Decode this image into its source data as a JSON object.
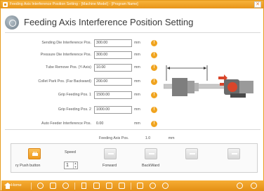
{
  "window": {
    "title": "Feeding Axis Interference Position Setting - [Machine Model] - [Program Name]",
    "close_glyph": "✕"
  },
  "header": {
    "title": "Feeding Axis Interference Position Setting",
    "icon": "gear-icon"
  },
  "params": [
    {
      "label": "Sending Die Interference Pos.",
      "value": "300.00",
      "unit": "mm"
    },
    {
      "label": "Pressure Die Interference Pos.",
      "value": "300.00",
      "unit": "mm"
    },
    {
      "label": "Tube Remove Pos. (Y-Axis)",
      "value": "10.00",
      "unit": "mm"
    },
    {
      "label": "Collet Park Pos. (Far Backward)",
      "value": "200.00",
      "unit": "mm"
    },
    {
      "label": "Grip Feeding Pos. 1",
      "value": "1500.00",
      "unit": "mm"
    },
    {
      "label": "Grip Feeding Pos. 2",
      "value": "1000.00",
      "unit": "mm"
    },
    {
      "label": "Auto Feeder Interference Pos.",
      "value": "0.00",
      "unit": "mm"
    }
  ],
  "warning_glyph": "!",
  "feeding_pos": {
    "label": "Feeding Axis Pos.",
    "value": "1.0",
    "unit": "mm"
  },
  "controls": {
    "jog_label": "ry Push button",
    "speed_label": "Speed",
    "speed_value": "1",
    "buttons": [
      {
        "label": "Forward"
      },
      {
        "label": "BackWard"
      },
      {
        "label": ""
      },
      {
        "label": ""
      }
    ]
  },
  "toolbar": {
    "home_label": "Home",
    "items": [
      "gear-icon",
      "lock-icon",
      "clock-icon",
      "document-icon",
      "list-icon",
      "list-icon",
      "folder-icon",
      "image-icon",
      "gear-icon",
      "help-icon",
      "back-icon",
      "next-icon"
    ]
  },
  "colors": {
    "accent": "#e8951a",
    "accent_light": "#f7b23a",
    "warning": "#f0a41f",
    "machine_red": "#d9452a"
  }
}
